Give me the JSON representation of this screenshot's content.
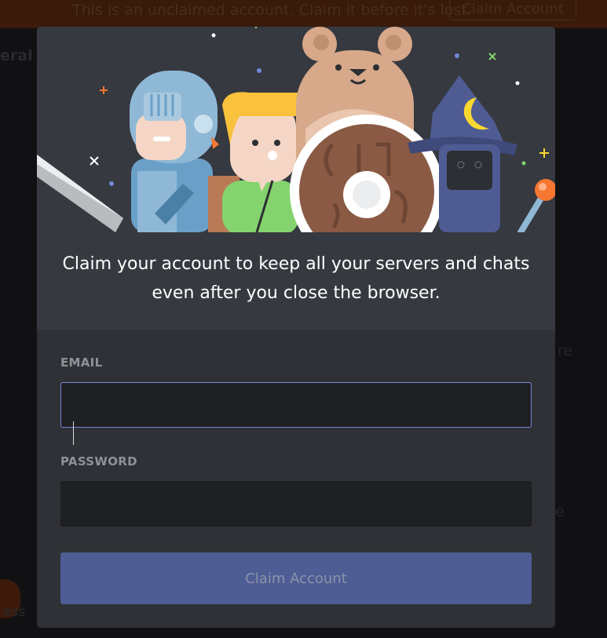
{
  "background": {
    "notice_text": "This is an unclaimed account. Claim it before it's lost.",
    "notice_button": "Claim Account",
    "channel_fragment": "eral",
    "ghost_right_1": "re",
    "ghost_right_2": "e",
    "ghost_bottom": "ess"
  },
  "modal": {
    "headline": "Claim your account to keep all your servers and chats even after you close the browser.",
    "email": {
      "label": "EMAIL",
      "value": "",
      "placeholder": ""
    },
    "password": {
      "label": "PASSWORD",
      "value": "",
      "placeholder": ""
    },
    "submit_label": "Claim Account"
  },
  "illustration": {
    "characters": [
      "knight-icon",
      "elf-icon",
      "bear-icon",
      "wizard-icon"
    ],
    "colors": {
      "knight": "#8fb8d6",
      "elf_hair": "#f9c13c",
      "elf_shirt": "#85d36e",
      "bear": "#d7a88a",
      "shield_wood": "#8a5a44",
      "wizard": "#4f5b93",
      "moon": "#f9d830"
    }
  },
  "colors": {
    "modal_bg": "#36393f",
    "form_bg": "#2f3136",
    "input_bg": "#1f2023",
    "focus_border": "#7289da",
    "button_bg": "#4e5d94",
    "button_text": "#8d92a8",
    "headline_text": "#ffffff",
    "label_text": "#8e9297"
  }
}
